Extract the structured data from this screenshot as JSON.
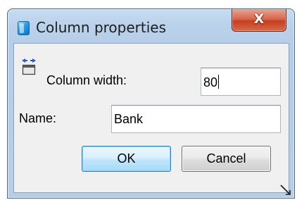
{
  "window": {
    "title": "Column properties",
    "close_glyph": "X",
    "app_icon": "app-icon",
    "close_icon": "close-icon"
  },
  "form": {
    "column_width": {
      "label": "Column width:",
      "value": "80",
      "icon": "column-width-icon"
    },
    "name": {
      "label": "Name:",
      "value": "Bank"
    }
  },
  "buttons": {
    "ok_label": "OK",
    "cancel_label": "Cancel"
  },
  "colors": {
    "frame": "#b9d1ea",
    "client": "#f0f0f0",
    "close_button": "#c4401f",
    "default_button_border": "#3c7fb1"
  }
}
